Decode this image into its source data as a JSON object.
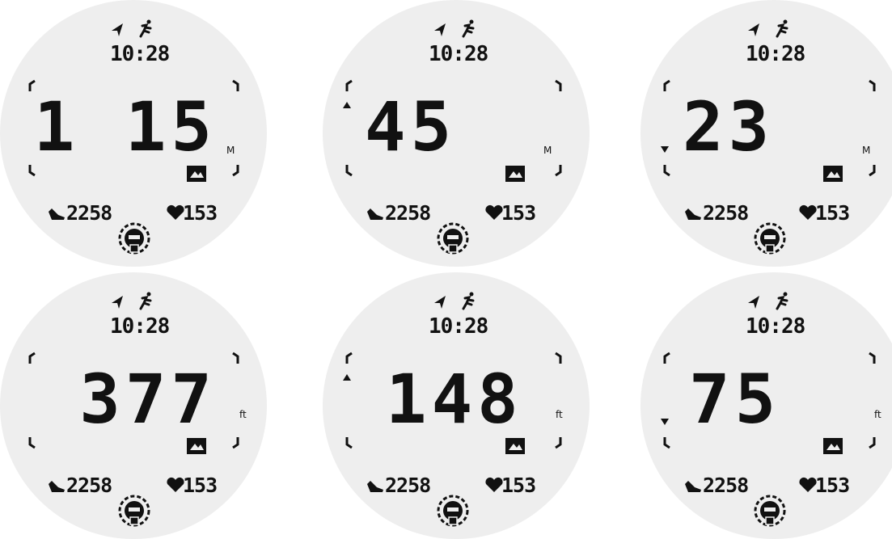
{
  "status": {
    "time": "10:28",
    "location_icon": "navigation-arrow-icon",
    "activity_icon": "running-icon"
  },
  "stats": {
    "steps": "2258",
    "heart_rate": "153",
    "steps_icon": "shoe-icon",
    "heart_icon": "heart-icon"
  },
  "faces": [
    {
      "value": "1 15",
      "unit": "M",
      "trend": "none"
    },
    {
      "value": "45",
      "unit": "M",
      "trend": "up"
    },
    {
      "value": "23",
      "unit": "M",
      "trend": "down"
    },
    {
      "value": "377",
      "unit": "ft",
      "trend": "none"
    },
    {
      "value": "148",
      "unit": "ft",
      "trend": "up"
    },
    {
      "value": "75",
      "unit": "ft",
      "trend": "down"
    }
  ],
  "colors": {
    "face": "#eeeeee",
    "ink": "#111111"
  }
}
